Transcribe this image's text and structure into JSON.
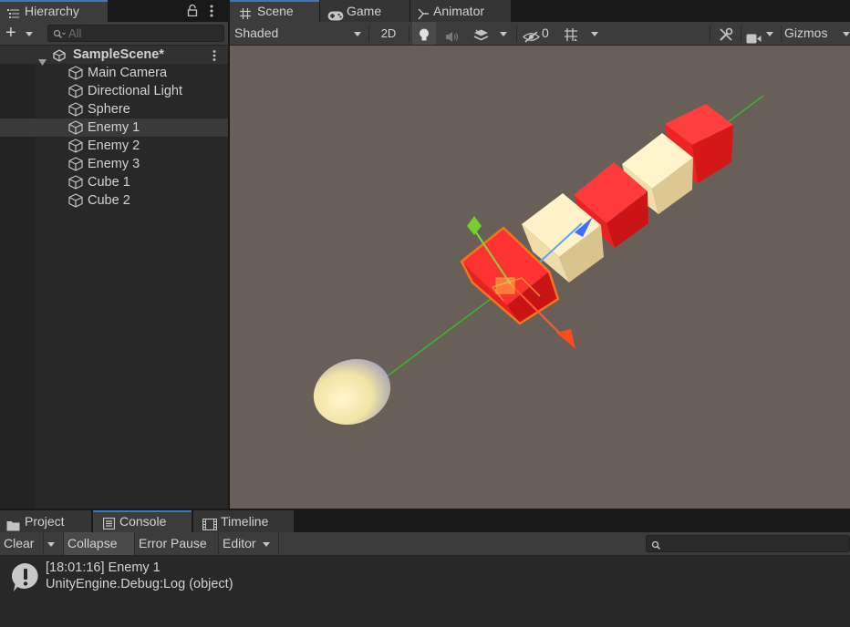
{
  "hierarchy": {
    "tab_label": "Hierarchy",
    "add_label": "+",
    "search_placeholder": "All",
    "scene_name": "SampleScene*",
    "items": [
      {
        "label": "Main Camera"
      },
      {
        "label": "Directional Light"
      },
      {
        "label": "Sphere"
      },
      {
        "label": "Enemy 1"
      },
      {
        "label": "Enemy 2"
      },
      {
        "label": "Enemy 3"
      },
      {
        "label": "Cube 1"
      },
      {
        "label": "Cube 2"
      }
    ],
    "selected_item": "Enemy 1"
  },
  "scene": {
    "tabs": [
      {
        "label": "Scene"
      },
      {
        "label": "Game"
      },
      {
        "label": "Animator"
      }
    ],
    "draw_mode": "Shaded",
    "mode_2d": "2D",
    "hidden_count": "0",
    "gizmos_label": "Gizmos"
  },
  "console": {
    "tabs": [
      {
        "label": "Project"
      },
      {
        "label": "Console"
      },
      {
        "label": "Timeline"
      }
    ],
    "toolbar": {
      "clear": "Clear",
      "collapse": "Collapse",
      "error_pause": "Error Pause",
      "editor": "Editor"
    },
    "log": {
      "line1": "[18:01:16] Enemy 1",
      "line2": "UnityEngine.Debug:Log (object)"
    }
  },
  "colors": {
    "accent": "#3a79bb",
    "viewport_bg": "#675f58",
    "enemy_red": "#e8202a",
    "cube_cream": "#f3e0b0",
    "selection_orange": "#f07818"
  }
}
